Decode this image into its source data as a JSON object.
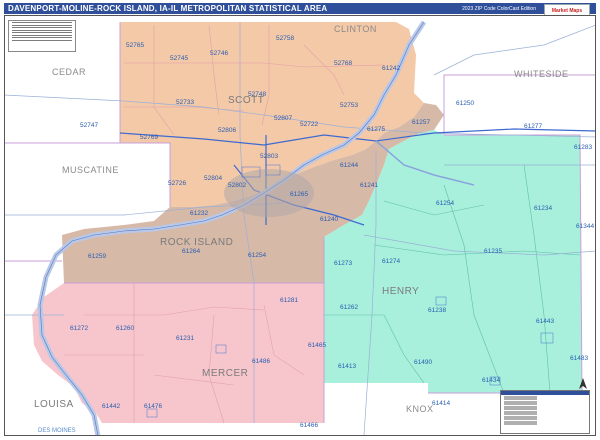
{
  "header": {
    "title": "DAVENPORT-MOLINE-ROCK ISLAND, IA-IL METROPOLITAN STATISTICAL AREA",
    "edition": "2023 ZIP Code ColorCast Edition",
    "logo_text": "Market Maps"
  },
  "colors": {
    "scott": "#f4c9a8",
    "rock_island": "#d7b9a8",
    "henry": "#a8f0dc",
    "mercer": "#f7c6cc",
    "outside": "#ffffff",
    "river": "#b8c8e8",
    "title_bar": "#2f4f9b"
  },
  "counties": {
    "cedar": "CEDAR",
    "clinton": "CLINTON",
    "whiteside": "WHITESIDE",
    "muscatine": "MUSCATINE",
    "scott": "SCOTT",
    "rock_island": "ROCK ISLAND",
    "henry": "HENRY",
    "mercer": "MERCER",
    "louisa": "LOUISA",
    "knox": "KNOX",
    "des_moines": "DES MOINES"
  },
  "zips": {
    "z52765": "52765",
    "z52745": "52745",
    "z52746": "52746",
    "z52758": "52758",
    "z52768": "52768",
    "z52733": "52733",
    "z52748": "52748",
    "z52753": "52753",
    "z52747": "52747",
    "z52769": "52769",
    "z52806": "52806",
    "z52807": "52807",
    "z52722": "52722",
    "z61242": "61242",
    "z61250": "61250",
    "z61275": "61275",
    "z61257": "61257",
    "z61277": "61277",
    "z61283": "61283",
    "z52803": "52803",
    "z61244": "61244",
    "z52726": "52726",
    "z52804": "52804",
    "z52802": "52802",
    "z61241": "61241",
    "z61265": "61265",
    "z61232": "61232",
    "z61240": "61240",
    "z61254": "61254",
    "z61234": "61234",
    "z61344": "61344",
    "z61259": "61259",
    "z61264": "61264",
    "z61273": "61273",
    "z61274": "61274",
    "z61235": "61235",
    "z61281": "61281",
    "z61262": "61262",
    "z61238": "61238",
    "z61272": "61272",
    "z61260": "61260",
    "z61231": "61231",
    "z61443": "61443",
    "z61465": "61465",
    "z61486": "61486",
    "z61413": "61413",
    "z61490": "61490",
    "z61483": "61483",
    "z61434": "61434",
    "z61442": "61442",
    "z61476": "61476",
    "z61414": "61414",
    "z61466": "61466"
  }
}
